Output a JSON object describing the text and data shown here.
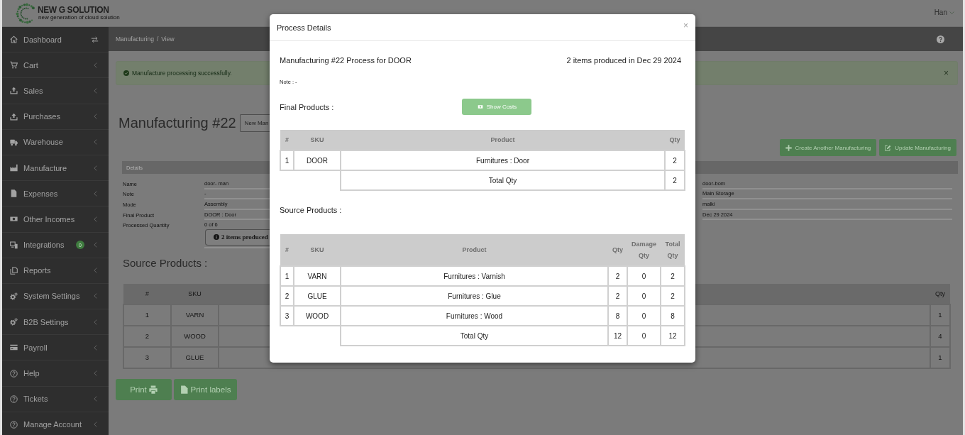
{
  "header": {
    "logo": {
      "name": "NEW G SOLUTION",
      "tagline": "new generation of cloud solution"
    },
    "user": {
      "name": "Han"
    }
  },
  "sidebar": {
    "items": [
      {
        "label": "Dashboard",
        "kind": "link"
      },
      {
        "label": "Cart",
        "kind": "tree"
      },
      {
        "label": "Sales",
        "kind": "tree"
      },
      {
        "label": "Purchases",
        "kind": "tree"
      },
      {
        "label": "Warehouse",
        "kind": "tree"
      },
      {
        "label": "Manufacture",
        "kind": "tree"
      },
      {
        "label": "Expenses",
        "kind": "tree"
      },
      {
        "label": "Other Incomes",
        "kind": "tree"
      },
      {
        "label": "Integrations",
        "kind": "tree",
        "badge": "0"
      },
      {
        "label": "Reports",
        "kind": "tree"
      },
      {
        "label": "System Settings",
        "kind": "tree"
      },
      {
        "label": "B2B Settings",
        "kind": "tree"
      },
      {
        "label": "Payroll",
        "kind": "tree"
      },
      {
        "label": "Help",
        "kind": "tree"
      },
      {
        "label": "Tickets",
        "kind": "tree"
      },
      {
        "label": "Manage Account",
        "kind": "tree"
      }
    ]
  },
  "breadcrumb": {
    "items": [
      {
        "label": "Manufacturing"
      },
      {
        "label": "View"
      }
    ],
    "separator": "/"
  },
  "alert": {
    "success": true,
    "text": "Manufacture processing successfully.",
    "close": "×"
  },
  "page": {
    "title": "Manufacturing #22",
    "title_button": "New Man",
    "actions": [
      {
        "label": "Create Another Manufacturing",
        "kind": "create"
      },
      {
        "label": "Update Manufacturing",
        "kind": "update"
      }
    ]
  },
  "details": {
    "heading": "Details",
    "rows": [
      {
        "label": "Name",
        "value": "door- man"
      },
      {
        "label": "Note",
        "value": "-"
      },
      {
        "label": "Mode",
        "value": "Assembly"
      },
      {
        "label": "Final Product",
        "value": "DOOR : Door"
      },
      {
        "label": "Processed Quantity",
        "value": "0 of 6"
      }
    ],
    "side_values": [
      "door-bom",
      "Main Storage",
      "malki",
      "Dec 29 2024"
    ],
    "info": "2 items produced"
  },
  "source_products": {
    "heading": "Source Products :",
    "columns": [
      "#",
      "SKU",
      "Qty"
    ],
    "rows": [
      {
        "index": "1",
        "sku": "VARN",
        "qty": "1"
      },
      {
        "index": "2",
        "sku": "WOOD",
        "qty": "4"
      },
      {
        "index": "3",
        "sku": "GLUE",
        "qty": "1"
      }
    ]
  },
  "footer_buttons": [
    {
      "label": "Print",
      "kind": "print"
    },
    {
      "label": "Print labels",
      "kind": "labels"
    }
  ],
  "modal": {
    "title": "Process Details",
    "close": "×",
    "heading": "Manufacturing #22 Process for DOOR",
    "summary": "2 items produced in Dec 29 2024",
    "note": "Note : -",
    "final_products": {
      "heading": "Final Products :",
      "show_costs_button": "Show Costs",
      "columns": [
        "#",
        "SKU",
        "Product",
        "Qty"
      ],
      "rows": [
        {
          "index": "1",
          "sku": "DOOR",
          "product": "Furnitures : Door",
          "qty": "2"
        }
      ],
      "total": {
        "label": "Total Qty",
        "qty": "2"
      }
    },
    "source_products": {
      "heading": "Source Products :",
      "columns": [
        "#",
        "SKU",
        "Product",
        "Qty",
        "Damage Qty",
        "Total Qty"
      ],
      "rows": [
        {
          "index": "1",
          "sku": "VARN",
          "product": "Furnitures : Varnish",
          "qty": "2",
          "damage_qty": "0",
          "total_qty": "2"
        },
        {
          "index": "2",
          "sku": "GLUE",
          "product": "Furnitures : Glue",
          "qty": "2",
          "damage_qty": "0",
          "total_qty": "2"
        },
        {
          "index": "3",
          "sku": "WOOD",
          "product": "Furnitures : Wood",
          "qty": "8",
          "damage_qty": "0",
          "total_qty": "8"
        }
      ],
      "total": {
        "label": "Total Qty",
        "qty": "12",
        "damage_qty": "0",
        "total_qty": "12"
      }
    }
  }
}
